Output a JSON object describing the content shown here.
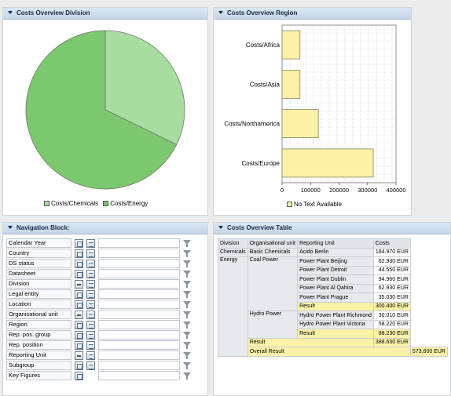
{
  "division_panel": {
    "title": "Costs Overview Division",
    "legend": [
      {
        "label": "Costs/Chemicals",
        "color": "#a8dca0"
      },
      {
        "label": "Costs/Energy",
        "color": "#7cc86e"
      }
    ]
  },
  "region_panel": {
    "title": "Costs Overview Region",
    "legend": "No Text Available"
  },
  "chart_data": [
    {
      "type": "pie",
      "labels": [
        "Costs/Chemicals",
        "Costs/Energy"
      ],
      "values": [
        184970,
        388630
      ],
      "colors": [
        "#a8dca0",
        "#7cc86e"
      ]
    },
    {
      "type": "bar",
      "orientation": "horizontal",
      "categories": [
        "Costs/Africa",
        "Costs/Asia",
        "Costs/Northamerica",
        "Costs/Europe"
      ],
      "values": [
        62930,
        62930,
        127510,
        320230
      ],
      "xlim": [
        0,
        400000
      ],
      "xticks": [
        "0",
        "100000",
        "200000",
        "300000",
        "400000"
      ],
      "bar_color": "#fbf2a8",
      "grid": true,
      "legend": "bottom"
    }
  ],
  "navigation": {
    "title": "Navigation Block:",
    "rows": [
      {
        "label": "Calendar Year",
        "icon": "i1",
        "icon2": "i2"
      },
      {
        "label": "Country",
        "icon": "i1",
        "icon2": "i2"
      },
      {
        "label": "DS status",
        "icon": "i1",
        "icon2": "i2"
      },
      {
        "label": "Datasheet",
        "icon": "i1",
        "icon2": "i2"
      },
      {
        "label": "Division",
        "icon": "i3",
        "icon2": "i2"
      },
      {
        "label": "Legal entity",
        "icon": "i1",
        "icon2": "i2"
      },
      {
        "label": "Location",
        "icon": "i1",
        "icon2": "i2"
      },
      {
        "label": "Organisational unit",
        "icon": "i3",
        "icon2": "i2"
      },
      {
        "label": "Region",
        "icon": "i1",
        "icon2": "i2"
      },
      {
        "label": "Rep. pos. group",
        "icon": "i1",
        "icon2": "i2"
      },
      {
        "label": "Rep. position",
        "icon": "i1",
        "icon2": "i2"
      },
      {
        "label": "Reporting Unit",
        "icon": "i3",
        "icon2": "i2"
      },
      {
        "label": "Subgroup",
        "icon": "i1",
        "icon2": "i2"
      },
      {
        "label": "Key Figures",
        "icon": "i1",
        "icon2": ""
      }
    ]
  },
  "costs_table": {
    "title": "Costs Overview Table",
    "headers": [
      "Division",
      "Organisational unit",
      "Reporting Unit",
      "Costs"
    ],
    "rows": [
      [
        "Chemicals",
        "Basic Chemicals",
        "Acido Berlin",
        "184.970 EUR"
      ],
      [
        "Energy",
        "Coal Power",
        "Power Plant Beijing",
        "62.930 EUR"
      ],
      [
        "",
        "",
        "Power Plant Detroit",
        "44.550 EUR"
      ],
      [
        "",
        "",
        "Power Plant Dublin",
        "94.960 EUR"
      ],
      [
        "",
        "",
        "Power Plant Al Qahira",
        "62.930 EUR"
      ],
      [
        "",
        "",
        "Power Plant Prague",
        "35.030 EUR"
      ],
      [
        "",
        "",
        "Result",
        "300.400 EUR"
      ],
      [
        "",
        "Hydro Power",
        "Hydro Power Plant Richmond",
        "30.010 EUR"
      ],
      [
        "",
        "",
        "Hydro Power Plant Victoria",
        "58.220 EUR"
      ],
      [
        "",
        "",
        "Result",
        "88.230 EUR"
      ],
      [
        "",
        "Result",
        "",
        "388.630 EUR"
      ],
      [
        "Overall Result",
        "",
        "",
        "573.600 EUR"
      ]
    ]
  }
}
